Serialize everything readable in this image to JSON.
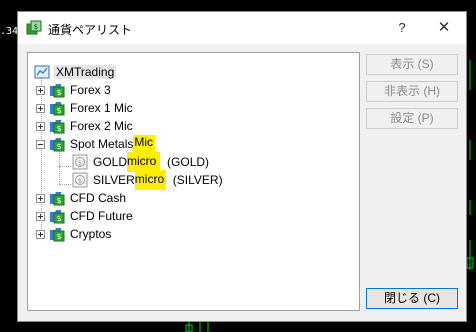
{
  "background": {
    "price_label": ".34"
  },
  "dialog": {
    "title": "通貨ペアリスト",
    "help_label": "?",
    "close_label": "✕"
  },
  "tree": {
    "root": "XMTrading",
    "groups": [
      {
        "label": "Forex 3",
        "expanded": false
      },
      {
        "label": "Forex 1 Mic",
        "expanded": false
      },
      {
        "label": "Forex 2 Mic",
        "expanded": false
      },
      {
        "label_main": "Spot Metals ",
        "label_highlight": "Mic",
        "expanded": true,
        "children": [
          {
            "name_main": "GOLD",
            "name_highlight": "micro",
            "suffix": "  (GOLD)"
          },
          {
            "name_main": "SILVER",
            "name_highlight": "micro",
            "suffix": "  (SILVER)"
          }
        ]
      },
      {
        "label": "CFD Cash",
        "expanded": false
      },
      {
        "label": "CFD Future",
        "expanded": false
      },
      {
        "label": "Cryptos",
        "expanded": false
      }
    ]
  },
  "buttons": {
    "show": "表示 (S)",
    "hide": "非表示 (H)",
    "settings": "設定 (P)",
    "close": "閉じる (C)"
  },
  "colors": {
    "highlight": "#ffee00",
    "folder_green": "#2aa52a",
    "folder_blue": "#2f7fd6",
    "focus_border": "#0078d7"
  }
}
